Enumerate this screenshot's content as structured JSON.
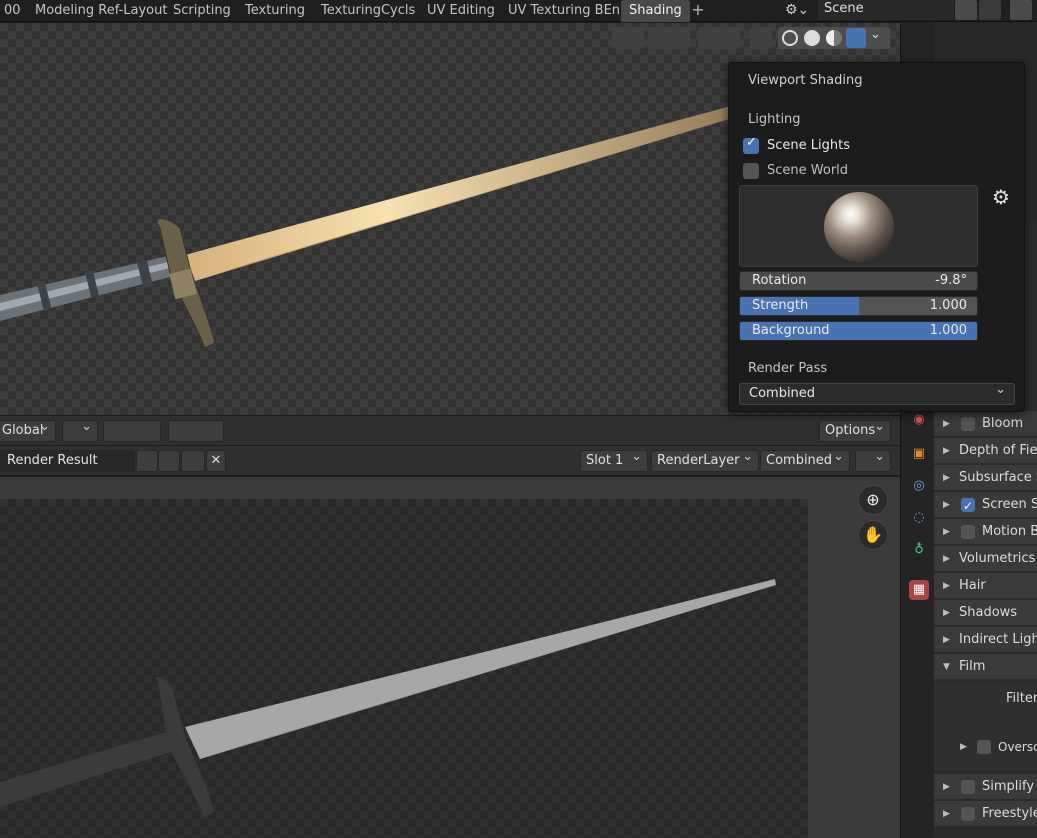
{
  "workspace_tabs": [
    {
      "label": "00"
    },
    {
      "label": "Modeling Ref-Layout"
    },
    {
      "label": "Scripting"
    },
    {
      "label": "Texturing"
    },
    {
      "label": "TexturingCycls"
    },
    {
      "label": "UV Editing"
    },
    {
      "label": "UV Texturing BEn"
    },
    {
      "label": "Shading",
      "active": true
    }
  ],
  "add_tab": "+",
  "scene": {
    "label": "Scene"
  },
  "viewport_shading": {
    "title": "Viewport Shading",
    "lighting_label": "Lighting",
    "scene_lights": {
      "label": "Scene Lights",
      "checked": true
    },
    "scene_world": {
      "label": "Scene World",
      "checked": false
    },
    "rotation": {
      "label": "Rotation",
      "value": "-9.8°"
    },
    "strength": {
      "label": "Strength",
      "value": "1.000",
      "fill_fraction": 0.5
    },
    "background": {
      "label": "Background",
      "value": "1.000",
      "fill_fraction": 1.0
    },
    "render_pass_label": "Render Pass",
    "render_pass_value": "Combined"
  },
  "viewport_footer": {
    "transform_orientation": "Global",
    "options_label": "Options"
  },
  "image_editor": {
    "image_name": "Render Result",
    "slot": "Slot 1",
    "render_layer": "RenderLayer",
    "pass": "Combined"
  },
  "properties": {
    "rows": [
      {
        "label": "Bloom",
        "arrow": "right",
        "checkbox": false
      },
      {
        "label": "Depth of Fie",
        "arrow": "right"
      },
      {
        "label": "Subsurface S",
        "arrow": "right"
      },
      {
        "label": "Screen S",
        "arrow": "right",
        "checkbox": true
      },
      {
        "label": "Motion B",
        "arrow": "right",
        "checkbox": false
      },
      {
        "label": "Volumetrics",
        "arrow": "right"
      },
      {
        "label": "Hair",
        "arrow": "right"
      },
      {
        "label": "Shadows",
        "arrow": "right"
      },
      {
        "label": "Indirect Ligh",
        "arrow": "right"
      },
      {
        "label": "Film",
        "arrow": "down"
      },
      {
        "label": "Filter"
      },
      {
        "label": "Oversc",
        "checkbox": false
      },
      {
        "label": "Simplify",
        "arrow": "right",
        "checkbox": false
      },
      {
        "label": "Freestyle",
        "arrow": "right",
        "checkbox": false
      }
    ]
  },
  "colors": {
    "accent": "#4772b3",
    "panel": "#303030",
    "popover": "#1b1b1b"
  }
}
